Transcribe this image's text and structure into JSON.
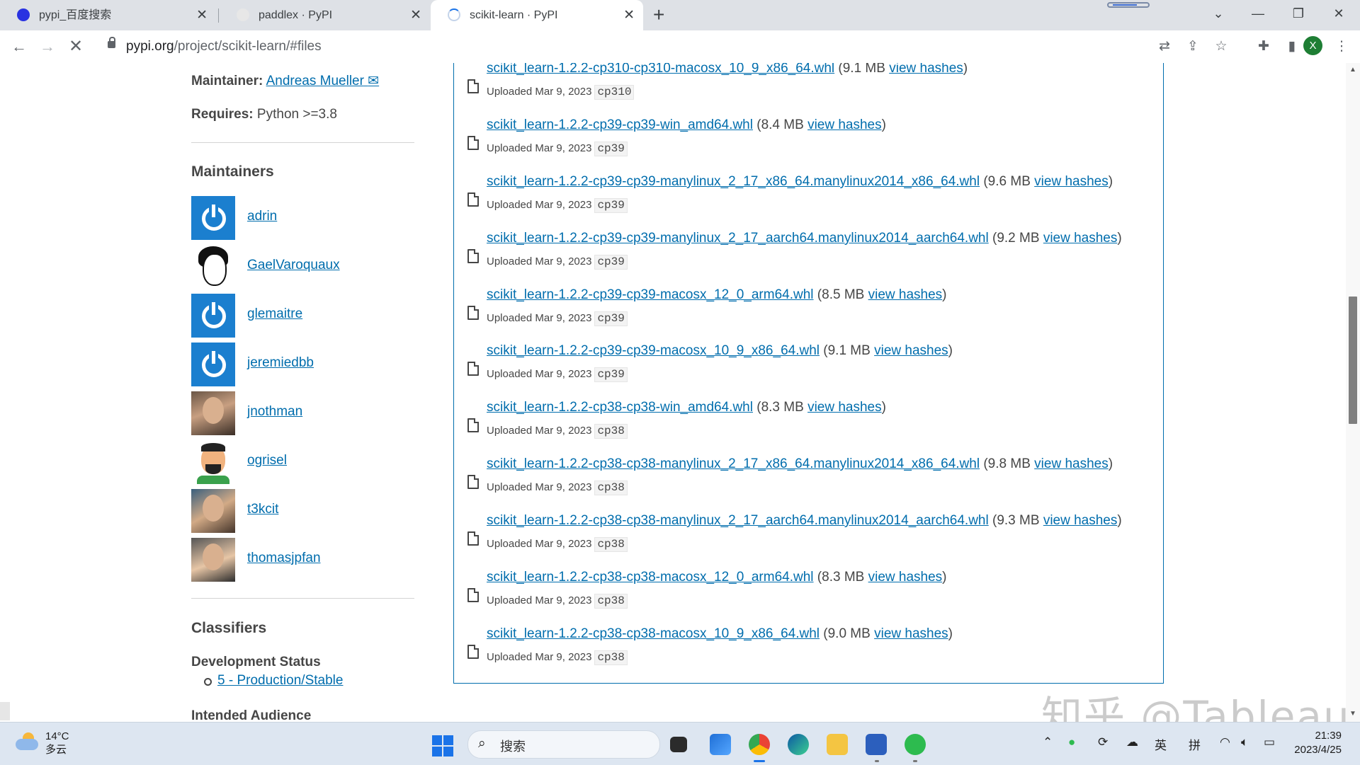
{
  "browser": {
    "tabs": [
      {
        "title": "pypi_百度搜索",
        "active": false
      },
      {
        "title": "paddlex · PyPI",
        "active": false
      },
      {
        "title": "scikit-learn · PyPI",
        "active": true
      }
    ],
    "url_host": "pypi.org",
    "url_path": "/project/scikit-learn/#files",
    "profile_initial": "X"
  },
  "sidebar": {
    "maintainer_label": "Maintainer:",
    "maintainer_name": "Andreas Mueller",
    "requires_label": "Requires:",
    "requires_value": "Python >=3.8",
    "maintainers_heading": "Maintainers",
    "maintainers": [
      {
        "username": "adrin",
        "avatar": "power-ring"
      },
      {
        "username": "GaelVaroquaux",
        "avatar": "sketch"
      },
      {
        "username": "glemaitre",
        "avatar": "power-ring"
      },
      {
        "username": "jeremiedbb",
        "avatar": "power-ring"
      },
      {
        "username": "jnothman",
        "avatar": "photo"
      },
      {
        "username": "ogrisel",
        "avatar": "cartoon"
      },
      {
        "username": "t3kcit",
        "avatar": "photo"
      },
      {
        "username": "thomasjpfan",
        "avatar": "photo"
      }
    ],
    "classifiers_heading": "Classifiers",
    "dev_status_heading": "Development Status",
    "dev_status_value": "5 - Production/Stable",
    "audience_heading": "Intended Audience"
  },
  "files": [
    {
      "name": "scikit_learn-1.2.2-cp310-cp310-macosx_10_9_x86_64.whl",
      "size": "(9.1 MB",
      "hashes": "view hashes",
      "close": ")",
      "uploaded": "Uploaded Mar 9, 2023",
      "tag": "cp310"
    },
    {
      "name": "scikit_learn-1.2.2-cp39-cp39-win_amd64.whl",
      "size": "(8.4 MB",
      "hashes": "view hashes",
      "close": ")",
      "uploaded": "Uploaded Mar 9, 2023",
      "tag": "cp39"
    },
    {
      "name": "scikit_learn-1.2.2-cp39-cp39-manylinux_2_17_x86_64.manylinux2014_x86_64.whl",
      "size": "(9.6 MB",
      "hashes": "view hashes",
      "close": ")",
      "uploaded": "Uploaded Mar 9, 2023",
      "tag": "cp39"
    },
    {
      "name": "scikit_learn-1.2.2-cp39-cp39-manylinux_2_17_aarch64.manylinux2014_aarch64.whl",
      "size": "(9.2 MB",
      "hashes": "view hashes",
      "close": ")",
      "uploaded": "Uploaded Mar 9, 2023",
      "tag": "cp39"
    },
    {
      "name": "scikit_learn-1.2.2-cp39-cp39-macosx_12_0_arm64.whl",
      "size": "(8.5 MB",
      "hashes": "view hashes",
      "close": ")",
      "uploaded": "Uploaded Mar 9, 2023",
      "tag": "cp39"
    },
    {
      "name": "scikit_learn-1.2.2-cp39-cp39-macosx_10_9_x86_64.whl",
      "size": "(9.1 MB",
      "hashes": "view hashes",
      "close": ")",
      "uploaded": "Uploaded Mar 9, 2023",
      "tag": "cp39"
    },
    {
      "name": "scikit_learn-1.2.2-cp38-cp38-win_amd64.whl",
      "size": "(8.3 MB",
      "hashes": "view hashes",
      "close": ")",
      "uploaded": "Uploaded Mar 9, 2023",
      "tag": "cp38"
    },
    {
      "name": "scikit_learn-1.2.2-cp38-cp38-manylinux_2_17_x86_64.manylinux2014_x86_64.whl",
      "size": "(9.8 MB",
      "hashes": "view hashes",
      "close": ")",
      "uploaded": "Uploaded Mar 9, 2023",
      "tag": "cp38"
    },
    {
      "name": "scikit_learn-1.2.2-cp38-cp38-manylinux_2_17_aarch64.manylinux2014_aarch64.whl",
      "size": "(9.3 MB",
      "hashes": "view hashes",
      "close": ")",
      "uploaded": "Uploaded Mar 9, 2023",
      "tag": "cp38"
    },
    {
      "name": "scikit_learn-1.2.2-cp38-cp38-macosx_12_0_arm64.whl",
      "size": "(8.3 MB",
      "hashes": "view hashes",
      "close": ")",
      "uploaded": "Uploaded Mar 9, 2023",
      "tag": "cp38"
    },
    {
      "name": "scikit_learn-1.2.2-cp38-cp38-macosx_10_9_x86_64.whl",
      "size": "(9.0 MB",
      "hashes": "view hashes",
      "close": ")",
      "uploaded": "Uploaded Mar 9, 2023",
      "tag": "cp38"
    }
  ],
  "watermark": "知乎 @Tableau",
  "taskbar": {
    "temperature": "14°C",
    "weather": "多云",
    "search_placeholder": "搜索",
    "ime_lang": "英",
    "ime_mode": "拼",
    "time": "21:39",
    "date": "2023/4/25"
  },
  "colors": {
    "link": "#006dad",
    "file_box_border": "#006dad",
    "tab_strip": "#dee1e6"
  }
}
